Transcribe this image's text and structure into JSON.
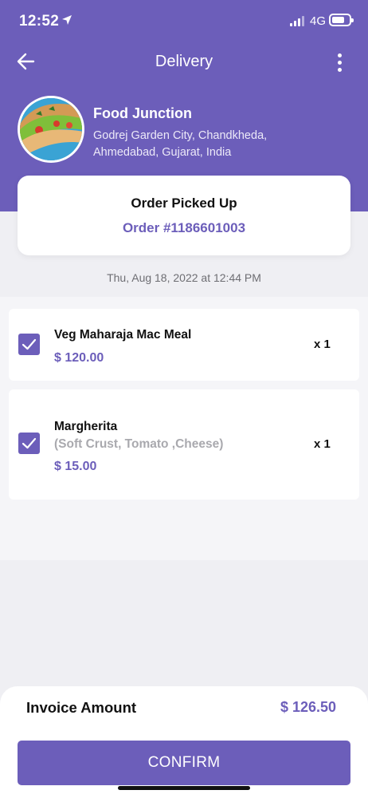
{
  "status_bar": {
    "time": "12:52",
    "network": "4G"
  },
  "header": {
    "title": "Delivery"
  },
  "restaurant": {
    "name": "Food Junction",
    "address": "Godrej Garden City, Chandkheda, Ahmedabad, Gujarat, India"
  },
  "order": {
    "status": "Order Picked Up",
    "number": "Order #1186601003",
    "datetime": "Thu, Aug 18, 2022 at 12:44 PM"
  },
  "items": [
    {
      "name": "Veg Maharaja Mac Meal",
      "options": "",
      "price": "$ 120.00",
      "qty": "x 1",
      "checked": true
    },
    {
      "name": "Margherita",
      "options": "(Soft Crust, Tomato  ,Cheese)",
      "price": "$ 15.00",
      "qty": "x 1",
      "checked": true
    }
  ],
  "invoice": {
    "label": "Invoice Amount",
    "amount": "$ 126.50"
  },
  "actions": {
    "confirm_label": "CONFIRM"
  },
  "colors": {
    "primary": "#6c5eba",
    "background": "#efeff3",
    "muted_text": "#a9a9ae"
  }
}
